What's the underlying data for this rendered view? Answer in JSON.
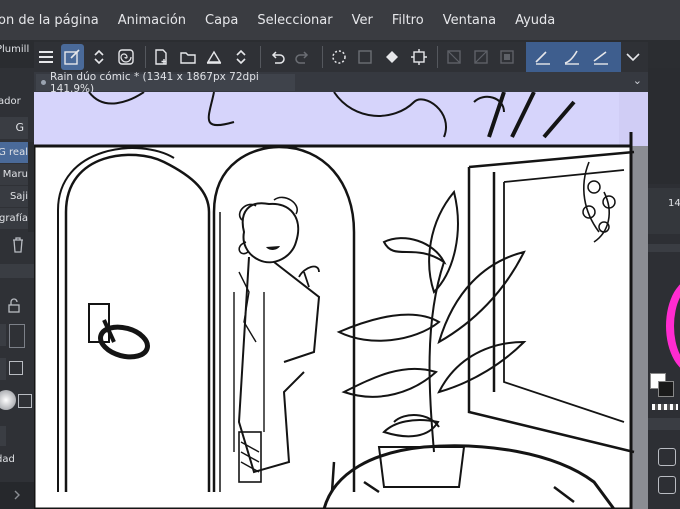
{
  "menu": {
    "items": [
      "on de la página",
      "Animación",
      "Capa",
      "Seleccionar",
      "Ver",
      "Filtro",
      "Ventana",
      "Ayuda"
    ]
  },
  "toolbar": {
    "icons": [
      "menu-icon",
      "selection-tool-icon",
      "toggle-arrows-icon",
      "spiral-icon",
      "new-page-icon",
      "open-folder-icon",
      "print-icon",
      "toggle-arrows-icon",
      "undo-icon",
      "redo-icon",
      "loading-icon",
      "transform-icon",
      "fill-icon",
      "crop-icon",
      "clear-icon",
      "clear-outside-icon",
      "frame-icon",
      "stabilizer-a-icon",
      "stabilizer-b-icon",
      "stabilizer-c-icon",
      "chevron-down-icon"
    ]
  },
  "document_tab": {
    "title": "Rain dúo cómic * (1341 x 1867px 72dpi 141.9%)"
  },
  "left_panel": {
    "tool_name": "Plumill",
    "subtool_group": "ador",
    "tab_letter": "G",
    "brushes": [
      "G real",
      "Maru",
      "Saji",
      "grafía"
    ],
    "property_label": "dad"
  },
  "right_panel": {
    "number": "14'",
    "color_main": "#ffffff",
    "color_sub": "#1a1a1a"
  },
  "colors": {
    "accent": "#4a6a99",
    "canvas_sky": "#d6d4fb",
    "paper": "#ffffff",
    "ink": "#141414",
    "hue_ring": "#ff2bd0"
  }
}
